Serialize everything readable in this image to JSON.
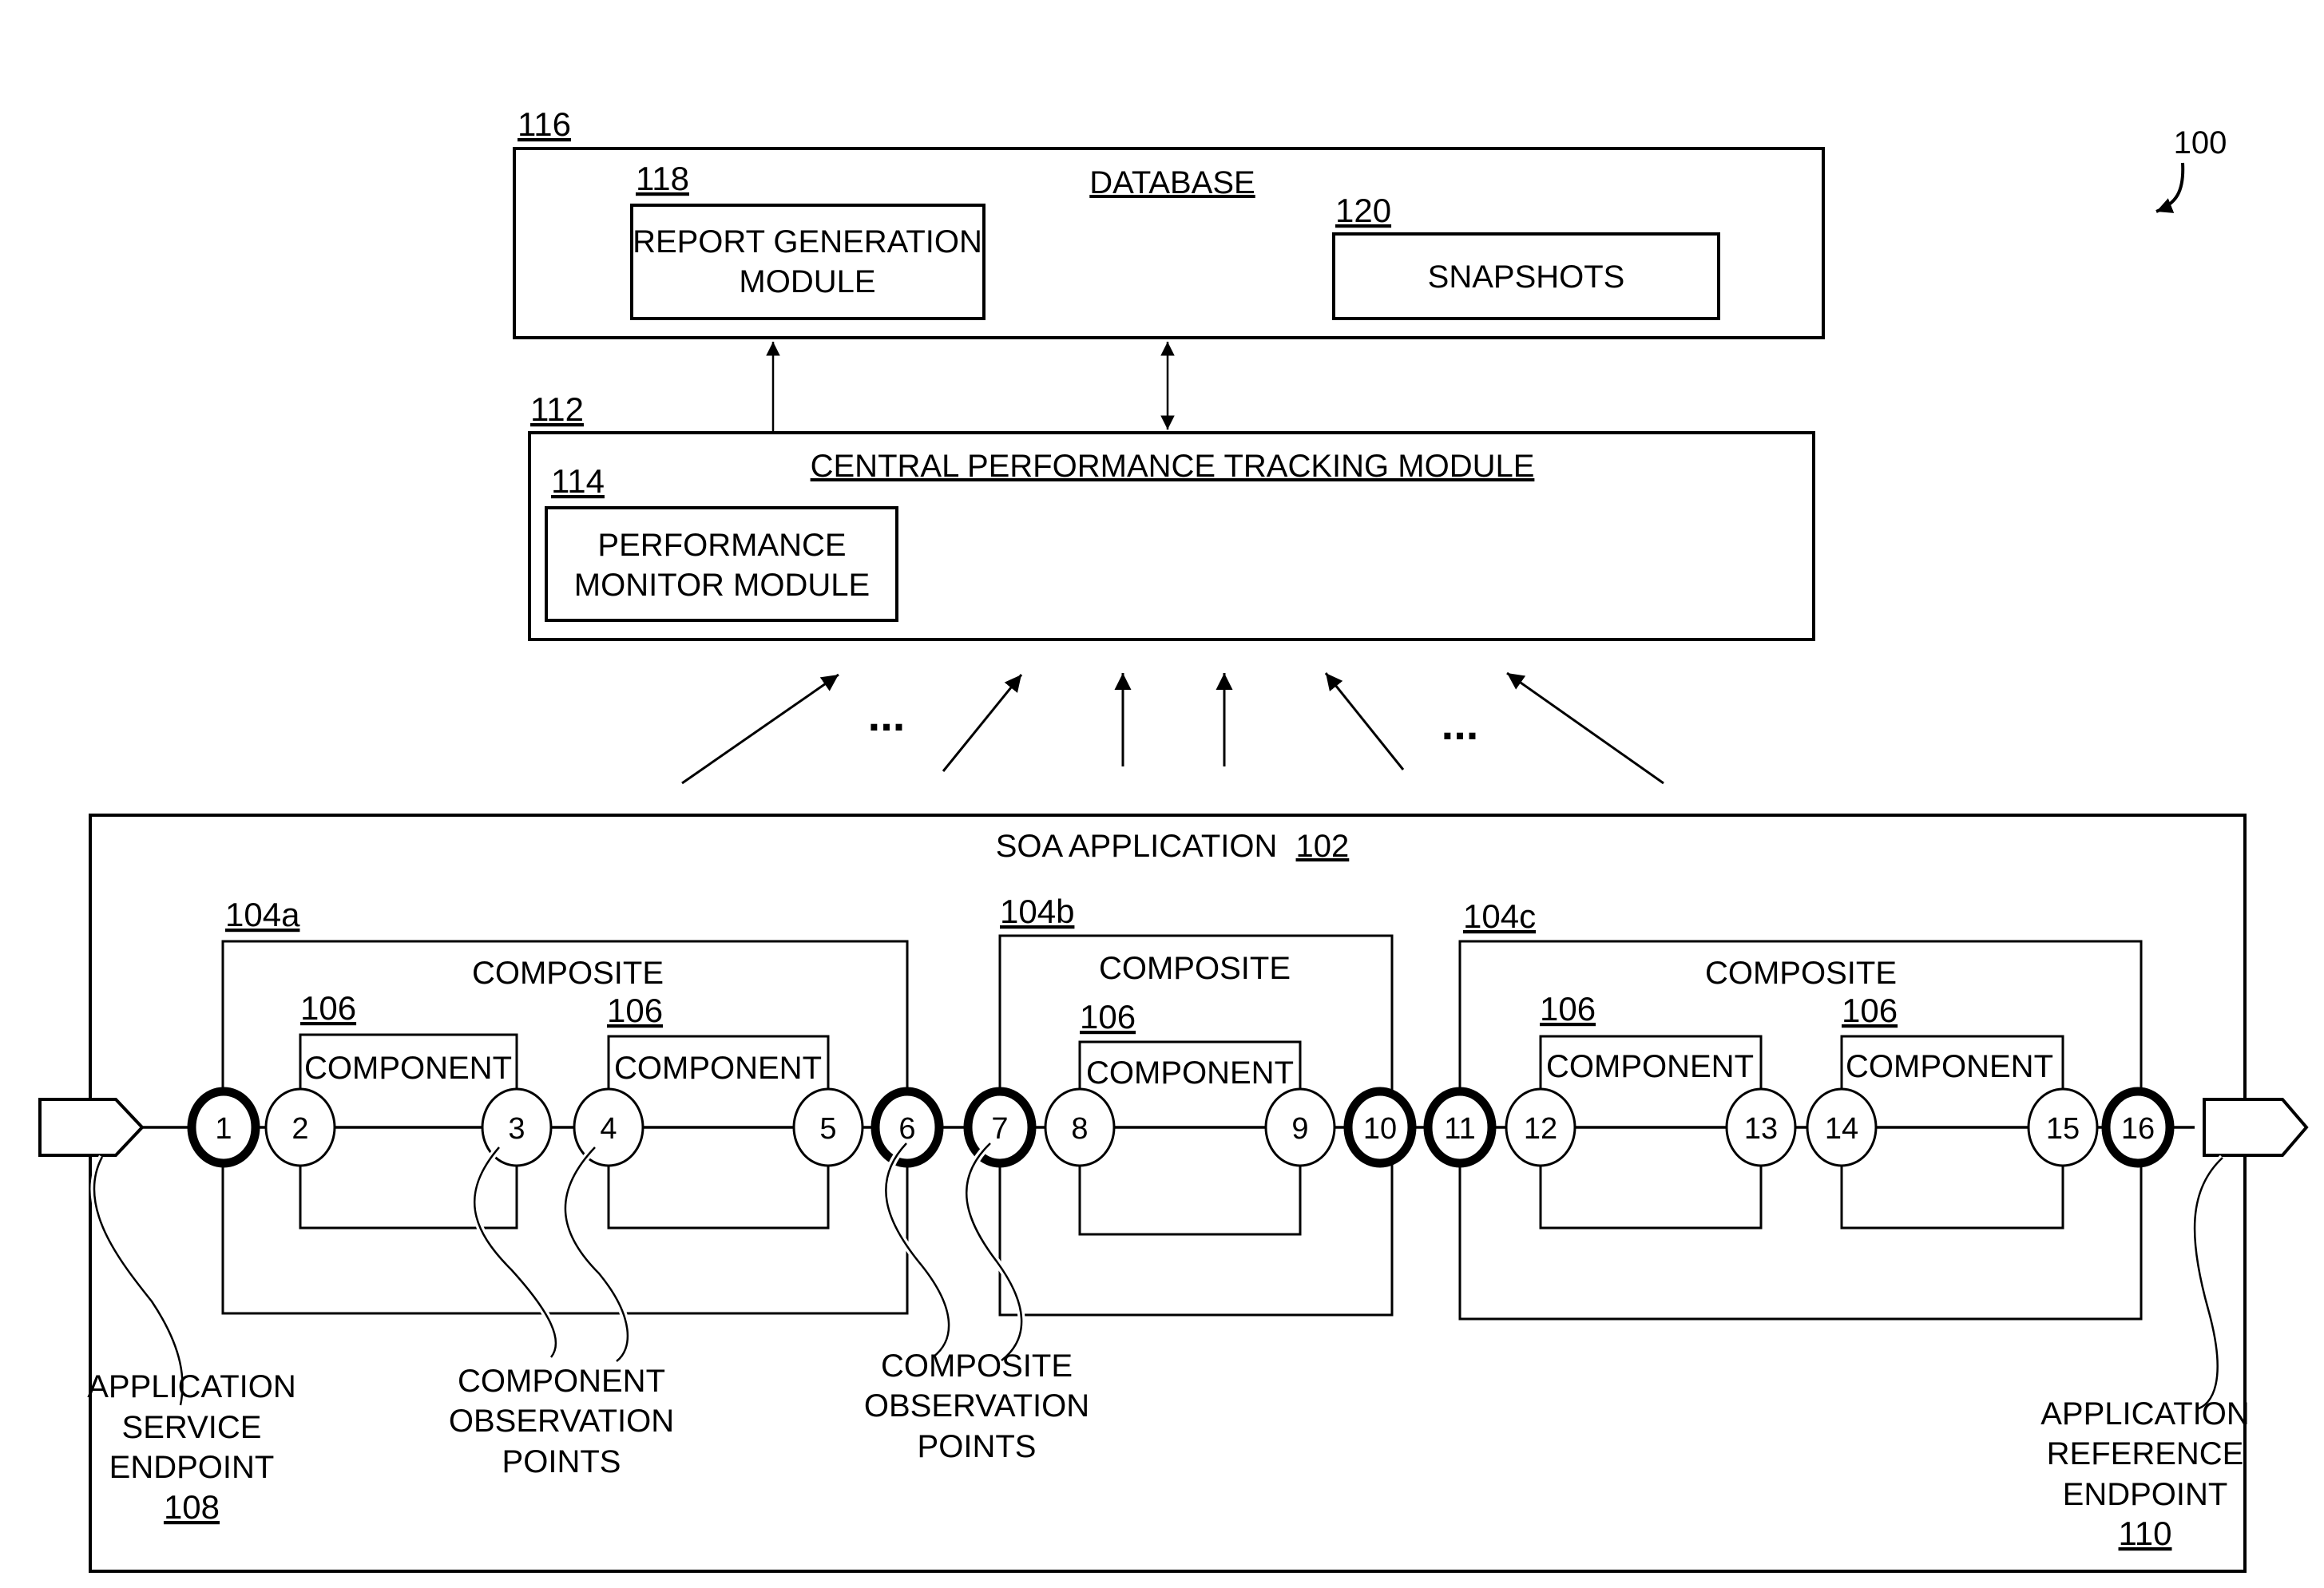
{
  "figure": {
    "ref": "100"
  },
  "database": {
    "ref": "116",
    "title": "DATABASE",
    "report_module": {
      "ref": "118",
      "lines": [
        "REPORT GENERATION",
        "MODULE"
      ]
    },
    "snapshots": {
      "ref": "120",
      "label": "SNAPSHOTS"
    }
  },
  "tracking": {
    "ref": "112",
    "title": "CENTRAL PERFORMANCE TRACKING MODULE",
    "monitor_module": {
      "ref": "114",
      "lines": [
        "PERFORMANCE",
        "MONITOR MODULE"
      ]
    }
  },
  "ellipsis": [
    "...",
    "..."
  ],
  "soa": {
    "title": "SOA APPLICATION",
    "ref": "102",
    "composites": [
      {
        "ref": "104a",
        "label": "COMPOSITE",
        "components": [
          {
            "ref": "106",
            "label": "COMPONENT"
          },
          {
            "ref": "106",
            "label": "COMPONENT"
          }
        ]
      },
      {
        "ref": "104b",
        "label": "COMPOSITE",
        "components": [
          {
            "ref": "106",
            "label": "COMPONENT"
          }
        ]
      },
      {
        "ref": "104c",
        "label": "COMPOSITE",
        "components": [
          {
            "ref": "106",
            "label": "COMPONENT"
          },
          {
            "ref": "106",
            "label": "COMPONENT"
          }
        ]
      }
    ],
    "observation_points": [
      {
        "n": "1",
        "kind": "composite"
      },
      {
        "n": "2",
        "kind": "component"
      },
      {
        "n": "3",
        "kind": "component"
      },
      {
        "n": "4",
        "kind": "component"
      },
      {
        "n": "5",
        "kind": "component"
      },
      {
        "n": "6",
        "kind": "composite"
      },
      {
        "n": "7",
        "kind": "composite"
      },
      {
        "n": "8",
        "kind": "component"
      },
      {
        "n": "9",
        "kind": "component"
      },
      {
        "n": "10",
        "kind": "composite"
      },
      {
        "n": "11",
        "kind": "composite"
      },
      {
        "n": "12",
        "kind": "component"
      },
      {
        "n": "13",
        "kind": "component"
      },
      {
        "n": "14",
        "kind": "component"
      },
      {
        "n": "15",
        "kind": "component"
      },
      {
        "n": "16",
        "kind": "composite"
      }
    ]
  },
  "callouts": {
    "service_endpoint": {
      "lines": [
        "APPLICATION",
        "SERVICE",
        "ENDPOINT"
      ],
      "ref": "108"
    },
    "component_points": {
      "lines": [
        "COMPONENT",
        "OBSERVATION",
        "POINTS"
      ]
    },
    "composite_points": {
      "lines": [
        "COMPOSITE",
        "OBSERVATION",
        "POINTS"
      ]
    },
    "reference_endpoint": {
      "lines": [
        "APPLICATION",
        "REFERENCE",
        "ENDPOINT"
      ],
      "ref": "110"
    }
  }
}
